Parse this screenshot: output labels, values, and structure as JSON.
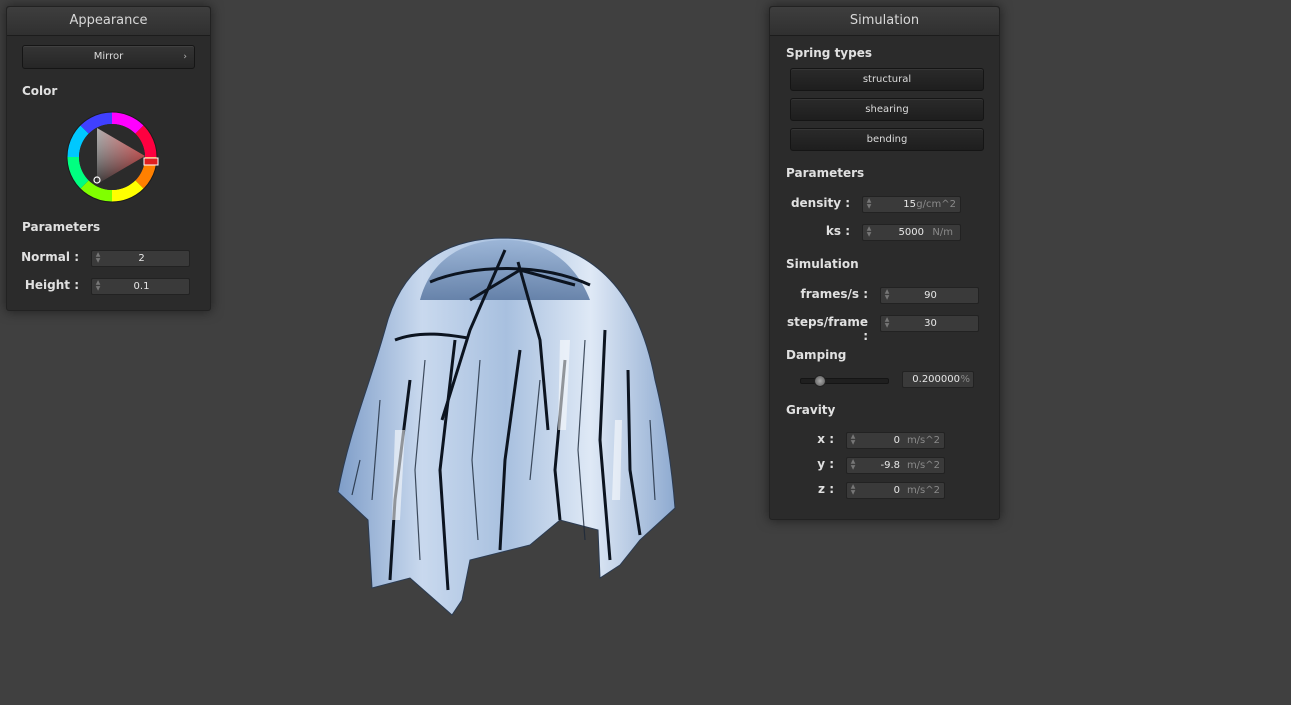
{
  "appearance": {
    "title": "Appearance",
    "shader_button": "Mirror",
    "color_label": "Color",
    "params_label": "Parameters",
    "normal_label": "Normal :",
    "normal_value": "2",
    "height_label": "Height :",
    "height_value": "0.1",
    "selected_color": "#e02020"
  },
  "simulation": {
    "title": "Simulation",
    "spring_types_label": "Spring types",
    "springs": [
      "structural",
      "shearing",
      "bending"
    ],
    "params_label": "Parameters",
    "density_label": "density :",
    "density_value": "15",
    "density_unit": "g/cm^2",
    "ks_label": "ks :",
    "ks_value": "5000",
    "ks_unit": "N/m",
    "sim_label": "Simulation",
    "fps_label": "frames/s :",
    "fps_value": "90",
    "steps_label": "steps/frame :",
    "steps_value": "30",
    "damping_label": "Damping",
    "damping_value": "0.200000",
    "damping_unit": "%",
    "damping_fraction": 0.2,
    "gravity_label": "Gravity",
    "gx_label": "x :",
    "gx_value": "0",
    "gy_label": "y :",
    "gy_value": "-9.8",
    "gz_label": "z :",
    "gz_value": "0",
    "gravity_unit": "m/s^2"
  }
}
